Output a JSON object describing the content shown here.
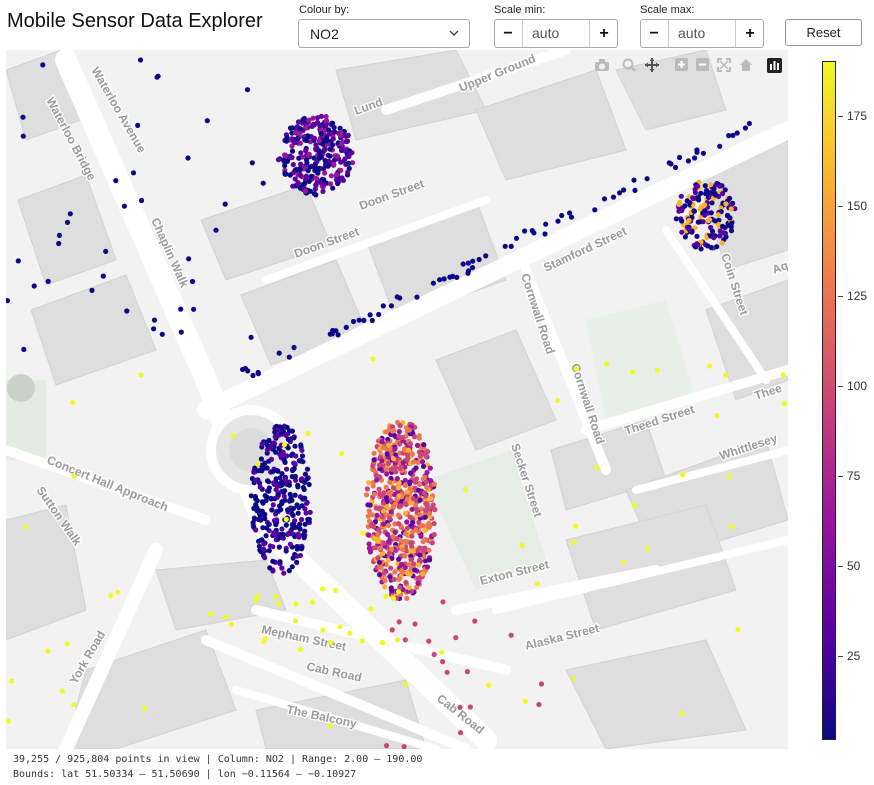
{
  "header": {
    "title": "Mobile Sensor Data Explorer",
    "colour_by_label": "Colour by:",
    "colour_by_value": "NO2",
    "scale_min_label": "Scale min:",
    "scale_min_value": "auto",
    "scale_max_label": "Scale max:",
    "scale_max_value": "auto",
    "minus": "−",
    "plus": "+",
    "reset_label": "Reset"
  },
  "map": {
    "streets": [
      "Waterloo Bridge",
      "Chaplin Walk",
      "Doon Street",
      "Doon Street",
      "Stamford Street",
      "Cornwall Road",
      "Cornwall Road",
      "Coin Street",
      "Theed Street",
      "Whittlesey",
      "Secker Street",
      "Concert Hall Approach",
      "Sutton Walk",
      "Exton Street",
      "Mepham Street",
      "Cab Road",
      "Cab Road",
      "Alaska Street",
      "York Road",
      "The Balcony",
      "Upper Ground",
      "Waterloo Avenue",
      "Aq",
      "Thee",
      "Lund"
    ]
  },
  "modebar": [
    "camera-icon",
    "zoom-icon",
    "pan-icon",
    "zoom-in-icon",
    "zoom-out-icon",
    "autoscale-icon",
    "home-icon",
    "plotly-logo-icon"
  ],
  "colorbar": {
    "ticks": [
      "175",
      "150",
      "125",
      "100",
      "75",
      "50",
      "25"
    ],
    "colors": [
      "#0d0887",
      "#5b02a3",
      "#9a179b",
      "#cb4678",
      "#eb7852",
      "#fbb32f",
      "#f0f921"
    ]
  },
  "footer": {
    "status": "39,255 / 925,804 points in view | Column: NO2 | Range: 2.00 – 190.00",
    "bounds": "Bounds: lat 51.50334 – 51.50690 | lon −0.11564 – −0.10927"
  }
}
